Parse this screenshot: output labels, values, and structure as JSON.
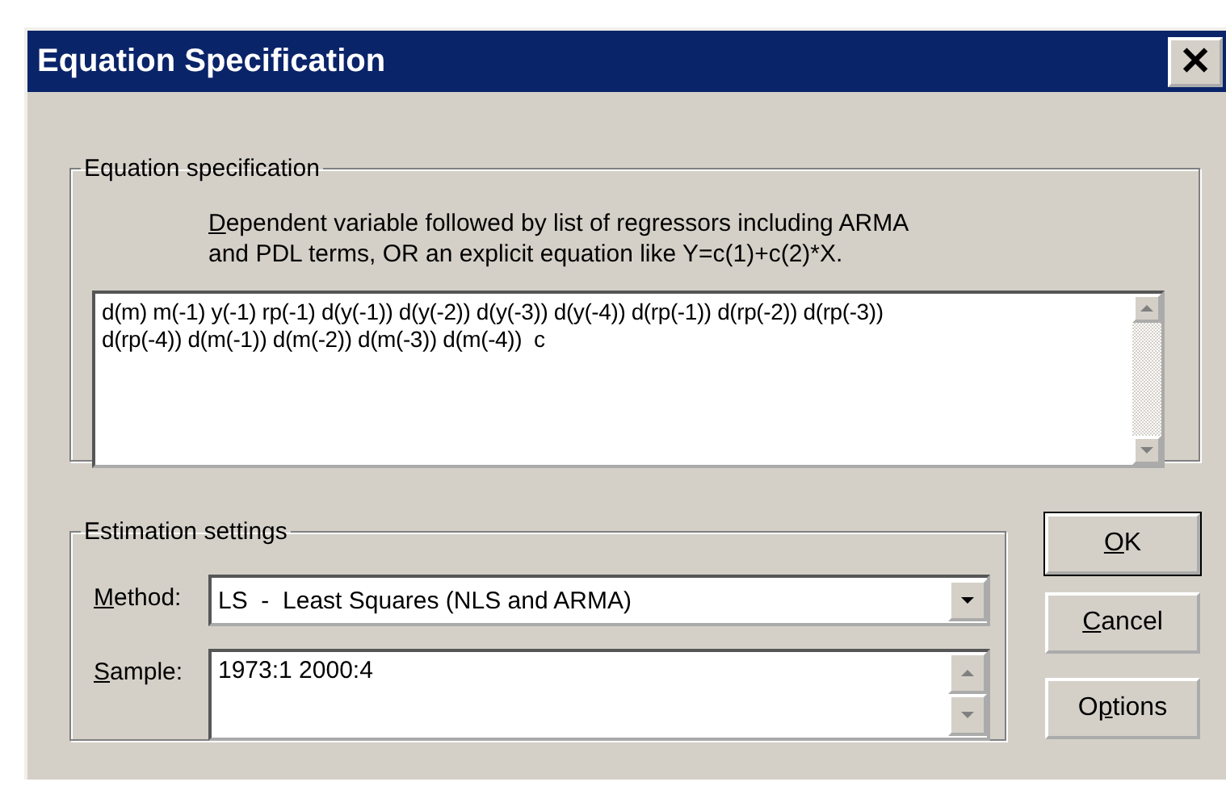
{
  "window": {
    "title": "Equation Specification",
    "close_label": "✕"
  },
  "equation_group": {
    "legend": "Equation specification",
    "description_lines": [
      [
        {
          "text": "D",
          "underlined": true
        },
        {
          "text": "ependent variable followed by list of regressors including ARMA",
          "underlined": false
        }
      ],
      [
        {
          "text": "and PDL terms, OR an explicit equation like Y=c(1)+c(2)*X.",
          "underlined": false
        }
      ]
    ],
    "value_lines": [
      "d(m) m(-1) y(-1) rp(-1) d(y(-1)) d(y(-2)) d(y(-3)) d(y(-4)) d(rp(-1)) d(rp(-2)) d(rp(-3))",
      "d(rp(-4)) d(m(-1)) d(m(-2)) d(m(-3)) d(m(-4))  c"
    ]
  },
  "estimation_group": {
    "legend": "Estimation settings",
    "method": {
      "label": [
        {
          "text": "M",
          "underlined": true
        },
        {
          "text": "ethod:",
          "underlined": false
        }
      ],
      "value": "LS  -  Least Squares (NLS and ARMA)"
    },
    "sample": {
      "label": [
        {
          "text": "S",
          "underlined": true
        },
        {
          "text": "ample:",
          "underlined": false
        }
      ],
      "value": "1973:1 2000:4"
    }
  },
  "buttons": [
    {
      "label": [
        {
          "text": "O",
          "underlined": true
        },
        {
          "text": "K",
          "underlined": false
        }
      ],
      "default": true
    },
    {
      "label": [
        {
          "text": "C",
          "underlined": true
        },
        {
          "text": "ancel",
          "underlined": false
        }
      ],
      "default": false
    },
    {
      "label": [
        {
          "text": "O",
          "underlined": false
        },
        {
          "text": "p",
          "underlined": true
        },
        {
          "text": "tions",
          "underlined": false
        }
      ],
      "default": false
    }
  ]
}
